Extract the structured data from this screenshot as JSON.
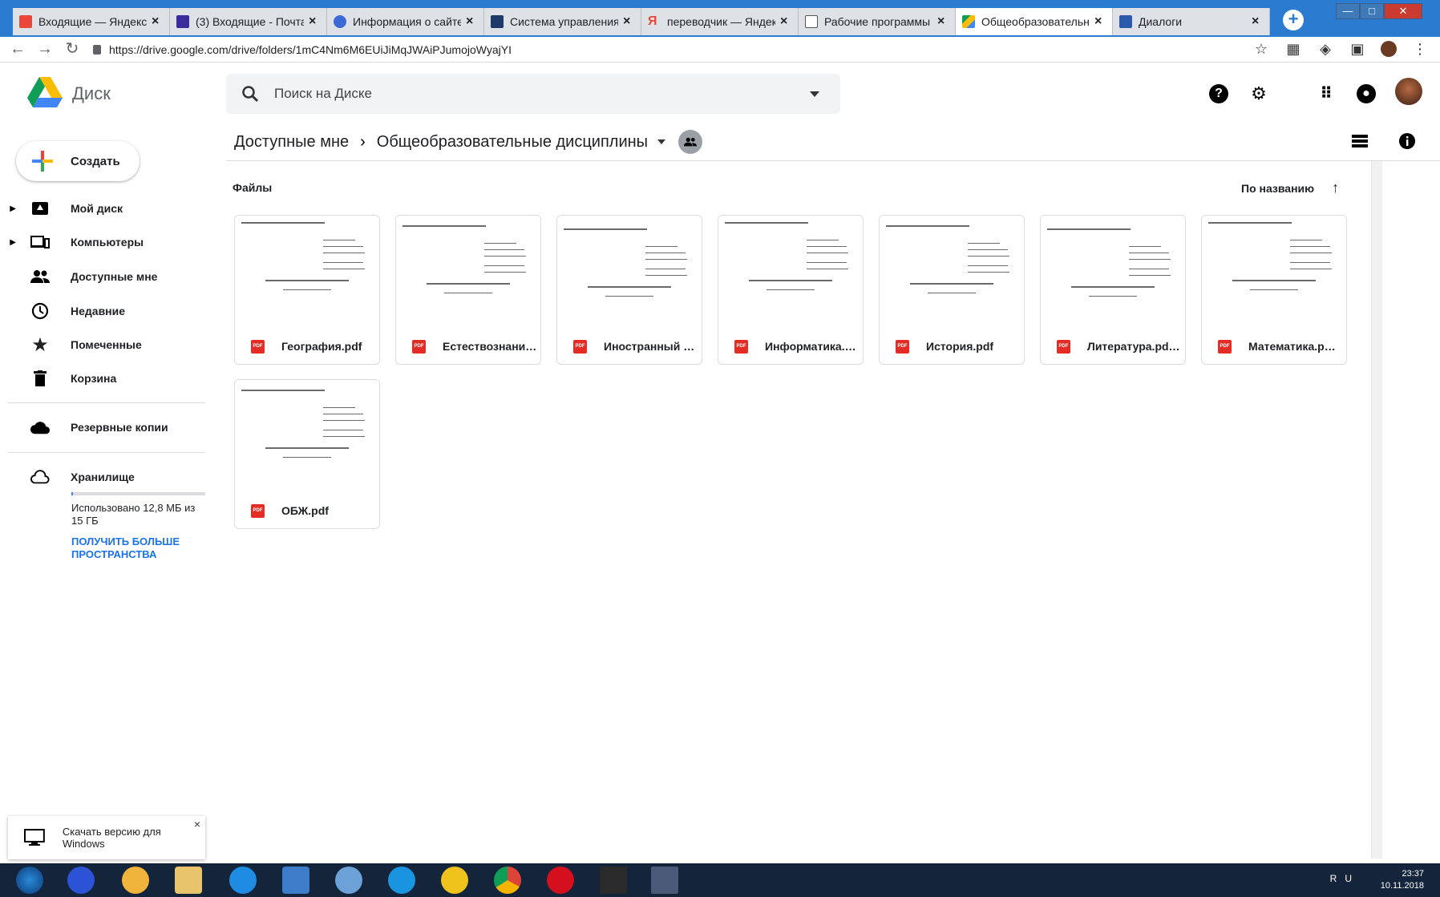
{
  "browser": {
    "tabs": [
      {
        "title": "Входящие — Яндекс.П",
        "favicon_color": "#e8473a"
      },
      {
        "title": "(3) Входящие - Почта",
        "favicon_color": "#3a2c9c"
      },
      {
        "title": "Информация о сайте",
        "favicon_color": "#3b6ad6"
      },
      {
        "title": "Система управления",
        "favicon_color": "#1d3a68"
      },
      {
        "title": "переводчик — Яндекс",
        "favicon_color": "#e8473a"
      },
      {
        "title": "Рабочие программы",
        "favicon_color": "#ffffff"
      },
      {
        "title": "Общеобразовательны",
        "favicon_color": "#fbbc04"
      },
      {
        "title": "Диалоги",
        "favicon_color": "#2d5bab"
      }
    ],
    "url": "https://drive.google.com/drive/folders/1mC4Nm6M6EUiJiMqJWAiPJumojoWyajYI"
  },
  "app": {
    "title": "Диск",
    "search_placeholder": "Поиск на Диске"
  },
  "sidebar": {
    "create_label": "Создать",
    "items": [
      {
        "label": "Мой диск"
      },
      {
        "label": "Компьютеры"
      },
      {
        "label": "Доступные мне"
      },
      {
        "label": "Недавние"
      },
      {
        "label": "Помеченные"
      },
      {
        "label": "Корзина"
      },
      {
        "label": "Резервные копии"
      },
      {
        "label": "Хранилище"
      }
    ],
    "storage": {
      "used_fraction": 0.001,
      "text": "Использовано 12,8 МБ из 15 ГБ",
      "upgrade_link": "Получить больше пространства"
    },
    "download_banner": "Скачать версию для Windows"
  },
  "main": {
    "breadcrumb_parent": "Доступные мне",
    "breadcrumb_current": "Общеобразовательные дисциплины",
    "files_label": "Файлы",
    "sort_label": "По названию",
    "files": [
      {
        "name": "География.pdf"
      },
      {
        "name": "Естествознани…"
      },
      {
        "name": "Иностранный …"
      },
      {
        "name": "Информатика.…"
      },
      {
        "name": "История.pdf"
      },
      {
        "name": "Литература.pd…"
      },
      {
        "name": "Математика.p…"
      },
      {
        "name": "ОБЖ.pdf"
      }
    ],
    "file_type_badge": "PDF"
  },
  "taskbar": {
    "lang": "RU",
    "time": "23:37",
    "date": "10.11.2018"
  },
  "colors": {
    "accent_blue": "#1a73e8",
    "pdf_red": "#e52c24",
    "chrome_blue": "#2b7bd1"
  }
}
